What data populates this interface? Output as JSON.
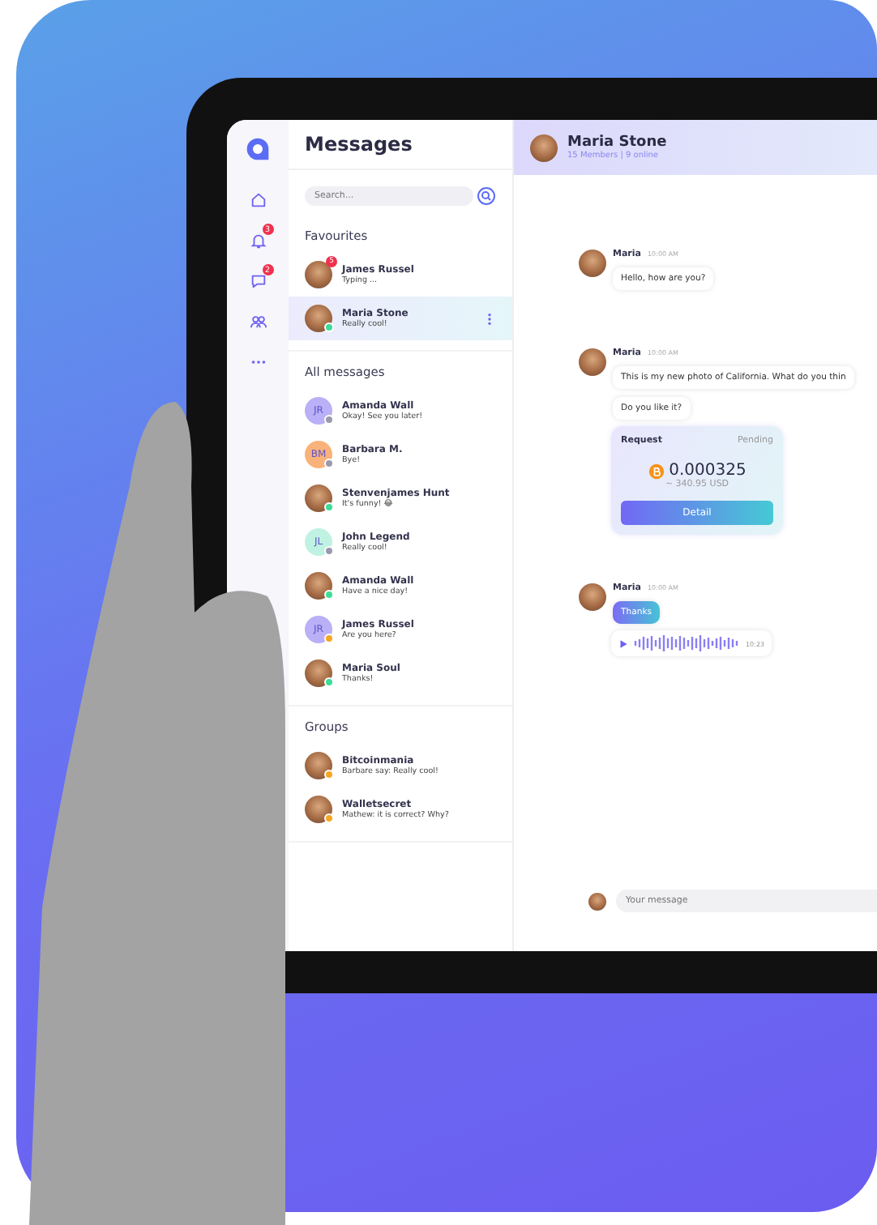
{
  "sidebar": {
    "items": [
      {
        "kind": "home"
      },
      {
        "kind": "bell",
        "badge": "3"
      },
      {
        "kind": "chat",
        "badge": "2"
      },
      {
        "kind": "people"
      },
      {
        "kind": "more"
      }
    ]
  },
  "conversations": {
    "title": "Messages",
    "search": {
      "placeholder": "Search..."
    },
    "sections": [
      {
        "title": "Favourites",
        "items": [
          {
            "name": "James Russel",
            "preview": "Typing ...",
            "avatar": {
              "kind": "photo"
            },
            "badge": "5",
            "selected": false
          },
          {
            "name": "Maria Stone",
            "preview": "Really cool!",
            "avatar": {
              "kind": "photo"
            },
            "status": {
              "color": "#3ddc97"
            },
            "selected": true
          }
        ]
      },
      {
        "title": "All messages",
        "items": [
          {
            "name": "Amanda Wall",
            "preview": "Okay! See you later!",
            "avatar": {
              "kind": "initials",
              "initials": "JR",
              "color": "#b9b0f7"
            },
            "status": {
              "color": "#9a9aae"
            },
            "selected": false
          },
          {
            "name": "Barbara M.",
            "preview": "Bye!",
            "avatar": {
              "kind": "initials",
              "initials": "BM",
              "color": "#f9b27a"
            },
            "status": {
              "color": "#9a9aae"
            },
            "selected": false
          },
          {
            "name": "Stenvenjames Hunt",
            "preview": "It's funny! 😂",
            "avatar": {
              "kind": "photo"
            },
            "status": {
              "color": "#3ddc97"
            },
            "selected": false
          },
          {
            "name": "John Legend",
            "preview": "Really cool!",
            "avatar": {
              "kind": "initials",
              "initials": "JL",
              "color": "#bff2e2"
            },
            "status": {
              "color": "#9a9aae"
            },
            "selected": false
          },
          {
            "name": "Amanda Wall",
            "preview": "Have a nice day!",
            "avatar": {
              "kind": "photo"
            },
            "status": {
              "color": "#3ddc97"
            },
            "selected": false
          },
          {
            "name": "James Russel",
            "preview": "Are you here?",
            "avatar": {
              "kind": "initials",
              "initials": "JR",
              "color": "#b9b0f7"
            },
            "status": {
              "color": "#f5a623"
            },
            "selected": false
          },
          {
            "name": "Maria Soul",
            "preview": "Thanks!",
            "avatar": {
              "kind": "photo"
            },
            "status": {
              "color": "#3ddc97"
            },
            "selected": false
          }
        ]
      },
      {
        "title": "Groups",
        "items": [
          {
            "name": "Bitcoinmania",
            "preview": "Barbare say: Really cool!",
            "avatar": {
              "kind": "photo"
            },
            "status": {
              "color": "#f5a623"
            },
            "selected": false
          },
          {
            "name": "Walletsecret",
            "preview": "Mathew: it is correct? Why?",
            "avatar": {
              "kind": "photo"
            },
            "status": {
              "color": "#f5a623"
            },
            "selected": false
          }
        ]
      }
    ]
  },
  "chat": {
    "title": "Maria Stone",
    "subtitle": "15 Members | 9 online",
    "messages": [
      {
        "kind": "text",
        "sender": "Maria",
        "time": "10:00 AM",
        "bubbles": [
          {
            "kind": "plain",
            "text": "Hello, how are you?"
          }
        ]
      },
      {
        "kind": "text",
        "sender": "Maria",
        "time": "10:00 AM",
        "bubbles": [
          {
            "kind": "plain",
            "text": "This is my new photo of California. What do you thin"
          },
          {
            "kind": "plain",
            "text": "Do you like it?"
          }
        ]
      },
      {
        "kind": "request",
        "label": "Request",
        "status": "Pending",
        "amount": "0.000325",
        "fiat": "~ 340.95 USD",
        "button": "Detail"
      },
      {
        "kind": "text",
        "sender": "Maria",
        "time": "10:00 AM",
        "bubbles": [
          {
            "kind": "accent",
            "text": "Thanks"
          }
        ]
      },
      {
        "kind": "audio",
        "duration": "10:23"
      }
    ],
    "composer": {
      "placeholder": "Your message"
    }
  }
}
